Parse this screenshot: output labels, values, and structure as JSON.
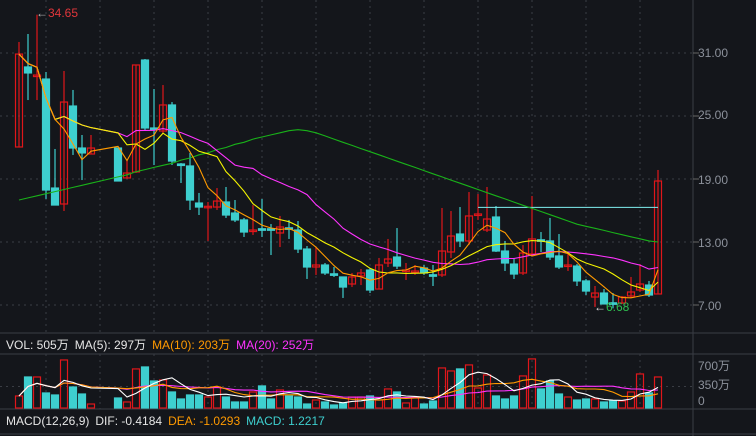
{
  "chart_data": [
    {
      "type": "candlestick",
      "y_ticks": [
        "31.00",
        "25.00",
        "19.00",
        "13.00",
        "7.00"
      ],
      "ylim": [
        4.5,
        36.5
      ],
      "grid": true,
      "high_label": "34.65",
      "low_label": "6.68",
      "reference_line": 16.3,
      "colors": {
        "up": "#e0161b",
        "down": "#3ecfcf",
        "ma5": "#ff9a00",
        "ma10": "#f5f500",
        "ma20": "#ff33ff",
        "ma60": "#19b219",
        "ref": "#7ff0f0"
      },
      "ohlc": [
        [
          22.05,
          30.9,
          32.05,
          22.05
        ],
        [
          29.67,
          29.1,
          32.81,
          26.52
        ],
        [
          28.81,
          28.9,
          34.65,
          26.52
        ],
        [
          28.52,
          17.95,
          29.19,
          17.1
        ],
        [
          18.14,
          16.52,
          21.86,
          16.52
        ],
        [
          16.62,
          26.33,
          29.29,
          15.95
        ],
        [
          25.95,
          21.95,
          27.48,
          21.29
        ],
        [
          21.95,
          21.48,
          23.19,
          18.9
        ],
        [
          21.38,
          21.95,
          23.19,
          21.38
        ],
        null,
        null,
        [
          21.95,
          18.81,
          21.95,
          18.81
        ],
        [
          19.1,
          19.57,
          20.81,
          19.1
        ],
        [
          19.67,
          29.86,
          29.86,
          19.57
        ],
        [
          30.33,
          23.86,
          30.43,
          23.67
        ],
        [
          23.86,
          23.8,
          27.57,
          20.33
        ],
        [
          23.57,
          26.05,
          27.95,
          23.38
        ],
        [
          26.05,
          20.71,
          26.33,
          20.33
        ],
        [
          20.43,
          20.4,
          20.52,
          18.62
        ],
        [
          20.24,
          17.0,
          21.48,
          16.05
        ],
        [
          16.71,
          16.33,
          17.67,
          15.57
        ],
        [
          16.3,
          16.4,
          16.81,
          13.1
        ],
        [
          16.33,
          16.9,
          18.14,
          16.05
        ],
        [
          16.81,
          15.57,
          18.24,
          15.29
        ],
        [
          15.76,
          15.1,
          17.0,
          14.9
        ],
        [
          15.1,
          13.95,
          15.29,
          13.48
        ],
        [
          14.1,
          14.14,
          16.52,
          13.67
        ],
        [
          14.26,
          14.24,
          17.1,
          13.48
        ],
        [
          14.26,
          14.24,
          14.71,
          11.76
        ],
        [
          13.86,
          14.43,
          15.48,
          12.52
        ],
        [
          14.35,
          14.33,
          15.1,
          13.29
        ],
        [
          14.14,
          12.33,
          15.0,
          11.95
        ],
        [
          12.33,
          10.62,
          12.62,
          9.48
        ],
        [
          10.62,
          10.81,
          12.52,
          9.86
        ],
        [
          10.81,
          10.05,
          11.0,
          9.86
        ],
        [
          9.97,
          9.95,
          10.62,
          9.67
        ],
        [
          9.67,
          8.71,
          9.67,
          7.67
        ],
        [
          9.0,
          9.67,
          10.05,
          8.71
        ],
        [
          9.76,
          10.05,
          10.43,
          8.9
        ],
        [
          10.33,
          8.43,
          10.52,
          8.14
        ],
        [
          8.52,
          10.81,
          11.48,
          8.52
        ],
        [
          11.0,
          11.38,
          13.29,
          10.62
        ],
        [
          11.57,
          10.71,
          14.33,
          10.43
        ],
        [
          10.3,
          10.33,
          11.0,
          9.38
        ],
        [
          10.22,
          10.24,
          10.81,
          9.86
        ],
        [
          10.52,
          10.05,
          10.81,
          9.86
        ],
        [
          9.88,
          9.86,
          10.81,
          8.81
        ],
        [
          9.86,
          12.14,
          16.24,
          9.67
        ],
        [
          12.05,
          13.57,
          15.95,
          11.48
        ],
        [
          13.76,
          13.1,
          16.33,
          12.52
        ],
        [
          13.1,
          15.48,
          17.76,
          12.71
        ],
        [
          15.65,
          15.67,
          17.57,
          15.1
        ],
        [
          14.14,
          15.19,
          18.24,
          13.95
        ],
        [
          15.38,
          12.14,
          16.43,
          12.05
        ],
        [
          12.14,
          11.0,
          13.1,
          10.24
        ],
        [
          10.9,
          9.95,
          11.48,
          9.48
        ],
        [
          10.05,
          11.95,
          12.71,
          9.86
        ],
        [
          11.86,
          13.29,
          17.38,
          11.76
        ],
        [
          13.21,
          13.19,
          13.95,
          12.05
        ],
        [
          13.1,
          11.57,
          15.29,
          11.29
        ],
        [
          11.67,
          10.62,
          13.76,
          10.43
        ],
        [
          10.79,
          10.81,
          11.95,
          10.24
        ],
        [
          10.71,
          9.29,
          10.9,
          8.81
        ],
        [
          9.29,
          8.33,
          9.48,
          7.95
        ],
        [
          7.76,
          8.14,
          8.81,
          6.81
        ],
        [
          8.14,
          7.1,
          8.52,
          7.1
        ],
        [
          7.21,
          7.19,
          8.14,
          6.68
        ],
        [
          7.19,
          7.76,
          7.86,
          7.1
        ],
        [
          7.86,
          8.24,
          9.67,
          7.67
        ],
        [
          8.43,
          9.0,
          10.9,
          8.24
        ],
        [
          8.9,
          7.95,
          9.29,
          7.76
        ],
        [
          8.05,
          18.81,
          19.86,
          8.05
        ]
      ],
      "ma60": [
        17.0,
        17.2,
        17.4,
        17.6,
        17.8,
        18.0,
        18.2,
        18.4,
        18.6,
        18.8,
        19.0,
        19.2,
        19.4,
        19.7,
        19.9,
        20.1,
        20.3,
        20.5,
        20.8,
        21.0,
        21.3,
        21.5,
        21.8,
        22.0,
        22.3,
        22.5,
        22.8,
        23.0,
        23.2,
        23.4,
        23.6,
        23.7,
        23.6,
        23.4,
        23.1,
        22.8,
        22.5,
        22.2,
        21.9,
        21.6,
        21.3,
        21.0,
        20.7,
        20.4,
        20.1,
        19.8,
        19.5,
        19.2,
        18.9,
        18.6,
        18.3,
        18.0,
        17.7,
        17.4,
        17.1,
        16.8,
        16.5,
        16.2,
        15.9,
        15.6,
        15.3,
        15.0,
        14.7,
        14.5,
        14.3,
        14.1,
        13.9,
        13.7,
        13.5,
        13.3,
        13.1,
        13.0
      ]
    },
    {
      "type": "bar",
      "title": "VOL",
      "unit": "万",
      "y_ticks": [
        "700万",
        "350万",
        "0"
      ],
      "ylim": [
        0,
        700
      ],
      "values": [
        196,
        505,
        505,
        245,
        212,
        782,
        342,
        228,
        65,
        null,
        null,
        163,
        98,
        636,
        668,
        440,
        456,
        261,
        147,
        212,
        212,
        179,
        342,
        179,
        98,
        98,
        261,
        359,
        147,
        293,
        196,
        179,
        65,
        130,
        98,
        49,
        82,
        179,
        179,
        196,
        130,
        310,
        261,
        82,
        163,
        65,
        114,
        652,
        603,
        636,
        701,
        326,
        538,
        196,
        147,
        196,
        522,
        799,
        310,
        440,
        228,
        179,
        130,
        147,
        147,
        98,
        114,
        114,
        261,
        554,
        245,
        505
      ],
      "colors": {
        "ma5": "#ffffff",
        "ma10": "#ff9a00",
        "ma20": "#ff33ff"
      }
    }
  ],
  "vol_legend": {
    "vol": "VOL: 505万",
    "ma5": "MA(5): 297万",
    "ma10": "MA(10): 203万",
    "ma20": "MA(20): 252万"
  },
  "macd_legend": {
    "name": "MACD(12,26,9)",
    "dif": "DIF: -0.4184",
    "dea": "DEA: -1.0293",
    "macd": "MACD: 1.2217"
  }
}
